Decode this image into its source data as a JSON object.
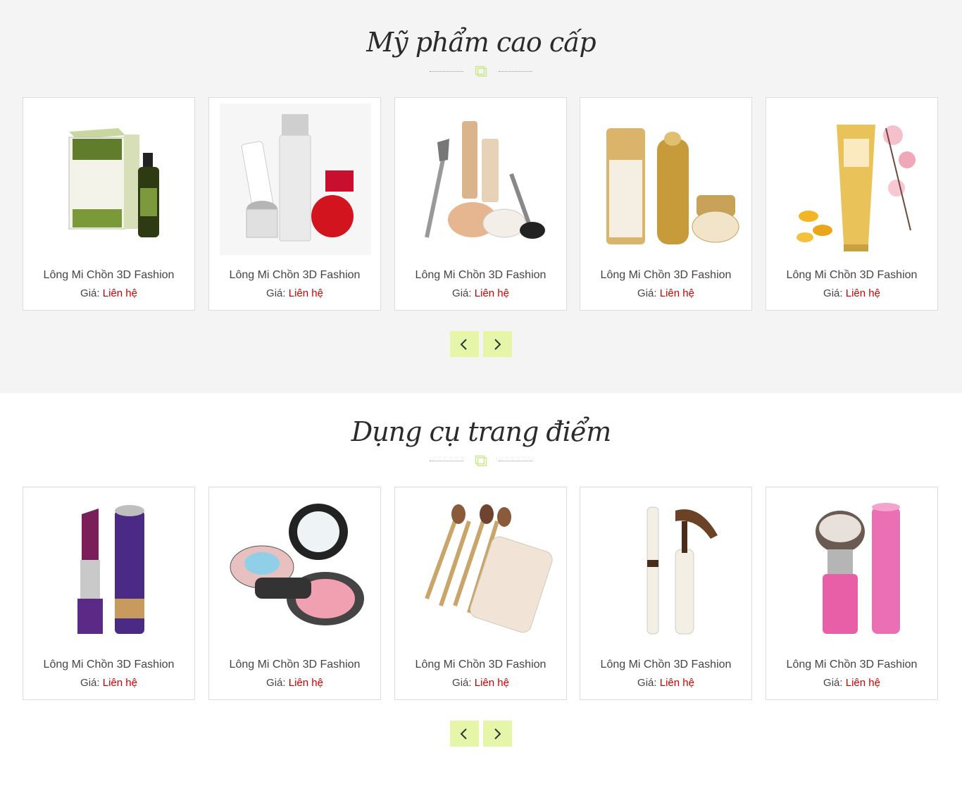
{
  "sections": [
    {
      "title": "Mỹ phẩm cao cấp",
      "products": [
        {
          "name": "Lông Mi Chồn 3D Fashion",
          "price_label": "Giá:",
          "price_value": "Liên hệ",
          "image": "olive-serum-image"
        },
        {
          "name": "Lông Mi Chồn 3D Fashion",
          "price_label": "Giá:",
          "price_value": "Liên hệ",
          "image": "skii-set-image"
        },
        {
          "name": "Lông Mi Chồn 3D Fashion",
          "price_label": "Giá:",
          "price_value": "Liên hệ",
          "image": "makeup-brush-set-image"
        },
        {
          "name": "Lông Mi Chồn 3D Fashion",
          "price_label": "Giá:",
          "price_value": "Liên hệ",
          "image": "gold-skincare-set-image"
        },
        {
          "name": "Lông Mi Chồn 3D Fashion",
          "price_label": "Giá:",
          "price_value": "Liên hệ",
          "image": "cream-tube-flowers-image"
        }
      ]
    },
    {
      "title": "Dụng cụ trang điểm",
      "products": [
        {
          "name": "Lông Mi Chồn 3D Fashion",
          "price_label": "Giá:",
          "price_value": "Liên hệ",
          "image": "lipstick-image"
        },
        {
          "name": "Lông Mi Chồn 3D Fashion",
          "price_label": "Giá:",
          "price_value": "Liên hệ",
          "image": "makeup-palette-image"
        },
        {
          "name": "Lông Mi Chồn 3D Fashion",
          "price_label": "Giá:",
          "price_value": "Liên hệ",
          "image": "brush-tin-set-image"
        },
        {
          "name": "Lông Mi Chồn 3D Fashion",
          "price_label": "Giá:",
          "price_value": "Liên hệ",
          "image": "brow-mascara-image"
        },
        {
          "name": "Lông Mi Chồn 3D Fashion",
          "price_label": "Giá:",
          "price_value": "Liên hệ",
          "image": "kabuki-brush-image"
        }
      ]
    }
  ],
  "nav": {
    "prev_icon": "chevron-left-icon",
    "next_icon": "chevron-right-icon"
  },
  "colors": {
    "section_bg": "#f4f4f4",
    "accent_green": "#e5f6a8",
    "divider_icon": "#cbe88a",
    "price_red": "#cc0000",
    "text": "#444444"
  }
}
